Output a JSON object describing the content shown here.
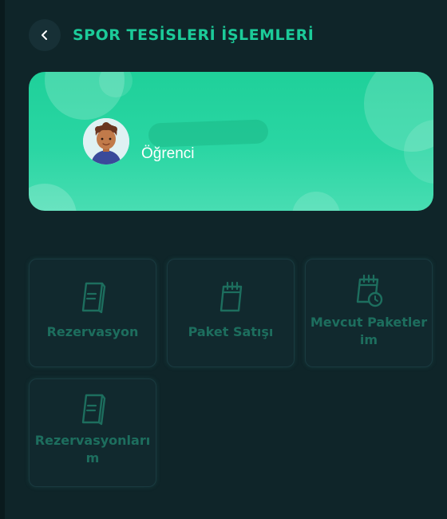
{
  "header": {
    "title": "SPOR TESİSLERİ İŞLEMLERİ",
    "back_icon": "chevron-left-icon"
  },
  "profile": {
    "role": "Öğrenci",
    "avatar_icon": "student-avatar-icon"
  },
  "menu": {
    "items": [
      {
        "label": "Rezervasyon",
        "icon": "document-icon"
      },
      {
        "label": "Paket Satışı",
        "icon": "calendar-icon"
      },
      {
        "label": "Mevcut Paketlerim",
        "icon": "calendar-clock-icon"
      },
      {
        "label": "Rezervasyonlarım",
        "icon": "document-icon"
      }
    ]
  },
  "colors": {
    "background": "#0f2529",
    "accent": "#1ccb99",
    "card_gradient_start": "#1fd09a",
    "card_gradient_end": "#48ddb2",
    "tile_label": "#1d6e5e"
  }
}
